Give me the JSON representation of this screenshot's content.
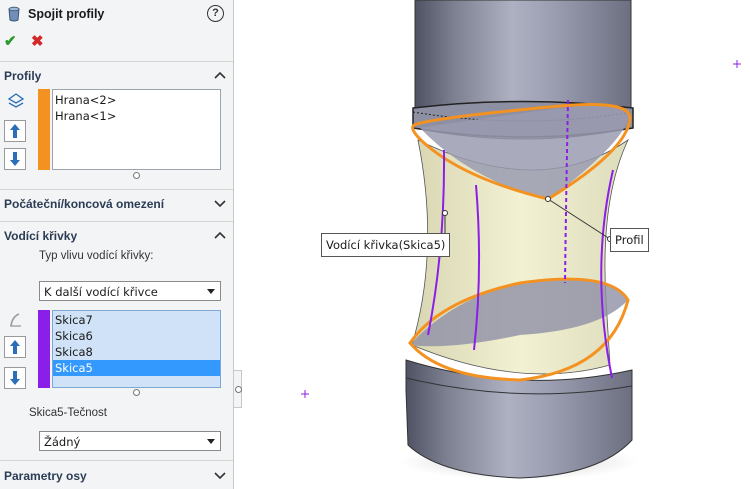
{
  "panel": {
    "title": "Spojit profily",
    "help_label": "?",
    "ok_label": "✔",
    "cancel_label": "✖"
  },
  "profiles": {
    "title": "Profily",
    "items": [
      "Hrana<2>",
      "Hrana<1>"
    ],
    "color": "#f39221"
  },
  "constraints": {
    "title": "Počáteční/koncová omezení"
  },
  "guides": {
    "title": "Vodící křivky",
    "influence_label": "Typ vlivu vodící křivky:",
    "influence_value": "K další vodící křivce",
    "items": [
      "Skica7",
      "Skica6",
      "Skica8",
      "Skica5"
    ],
    "selected_item": "Skica5",
    "color": "#8b1fe8",
    "tangency_label": "Skica5-Tečnost",
    "tangency_value": "Žádný"
  },
  "axis_params": {
    "title": "Parametry osy"
  },
  "viewport": {
    "callout_guide": "Vodící křivka(Skica5)",
    "callout_profile": "Profil"
  },
  "colors": {
    "profile_orange": "#f39221",
    "guide_purple": "#8b1fe8",
    "selection_blue": "#3399ff",
    "list_bg_blue": "#cfe2f7"
  }
}
